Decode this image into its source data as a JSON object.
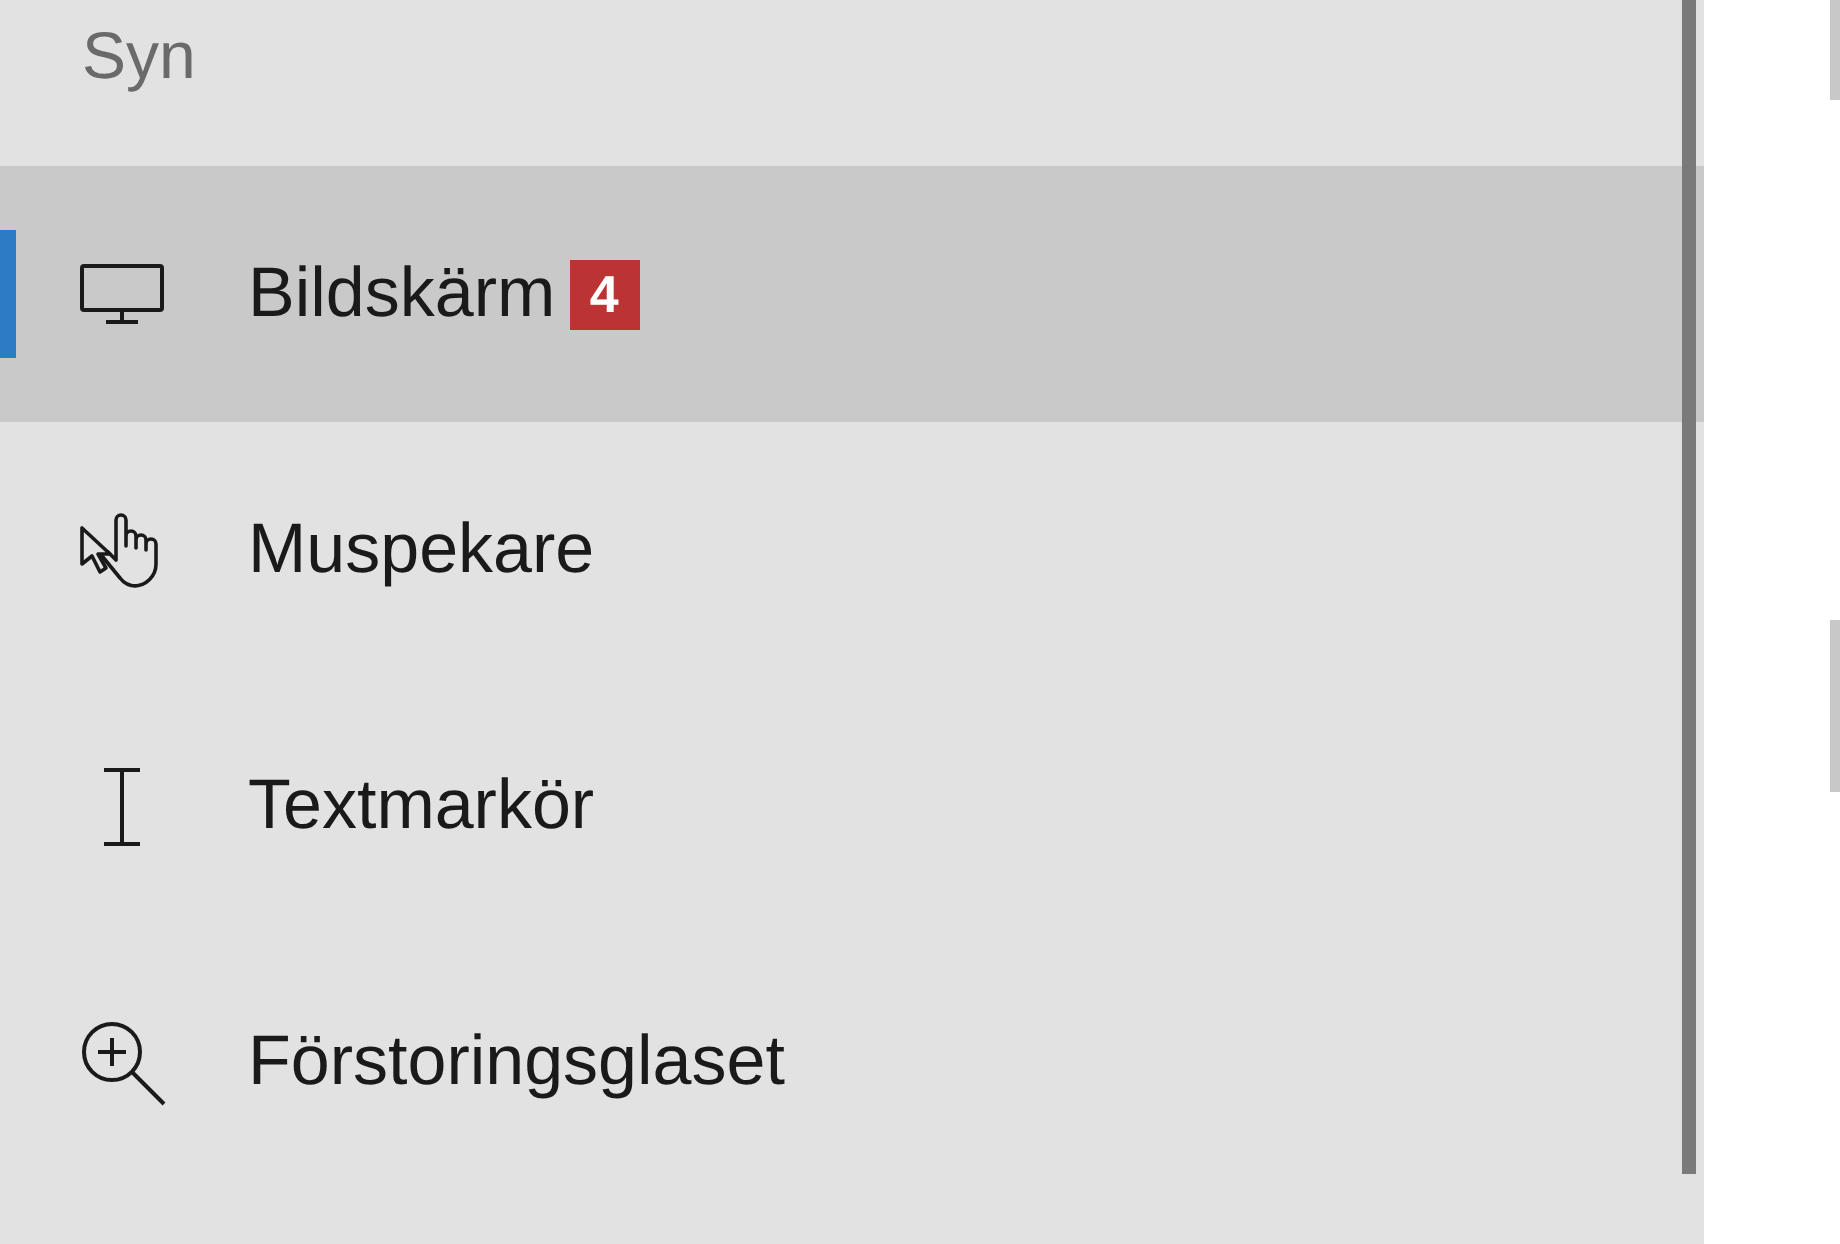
{
  "sidebar": {
    "heading": "Syn",
    "items": [
      {
        "label": "Bildskärm",
        "selected": true,
        "badge": "4"
      },
      {
        "label": "Muspekare",
        "selected": false
      },
      {
        "label": "Textmarkör",
        "selected": false
      },
      {
        "label": "Förstoringsglaset",
        "selected": false
      }
    ]
  }
}
